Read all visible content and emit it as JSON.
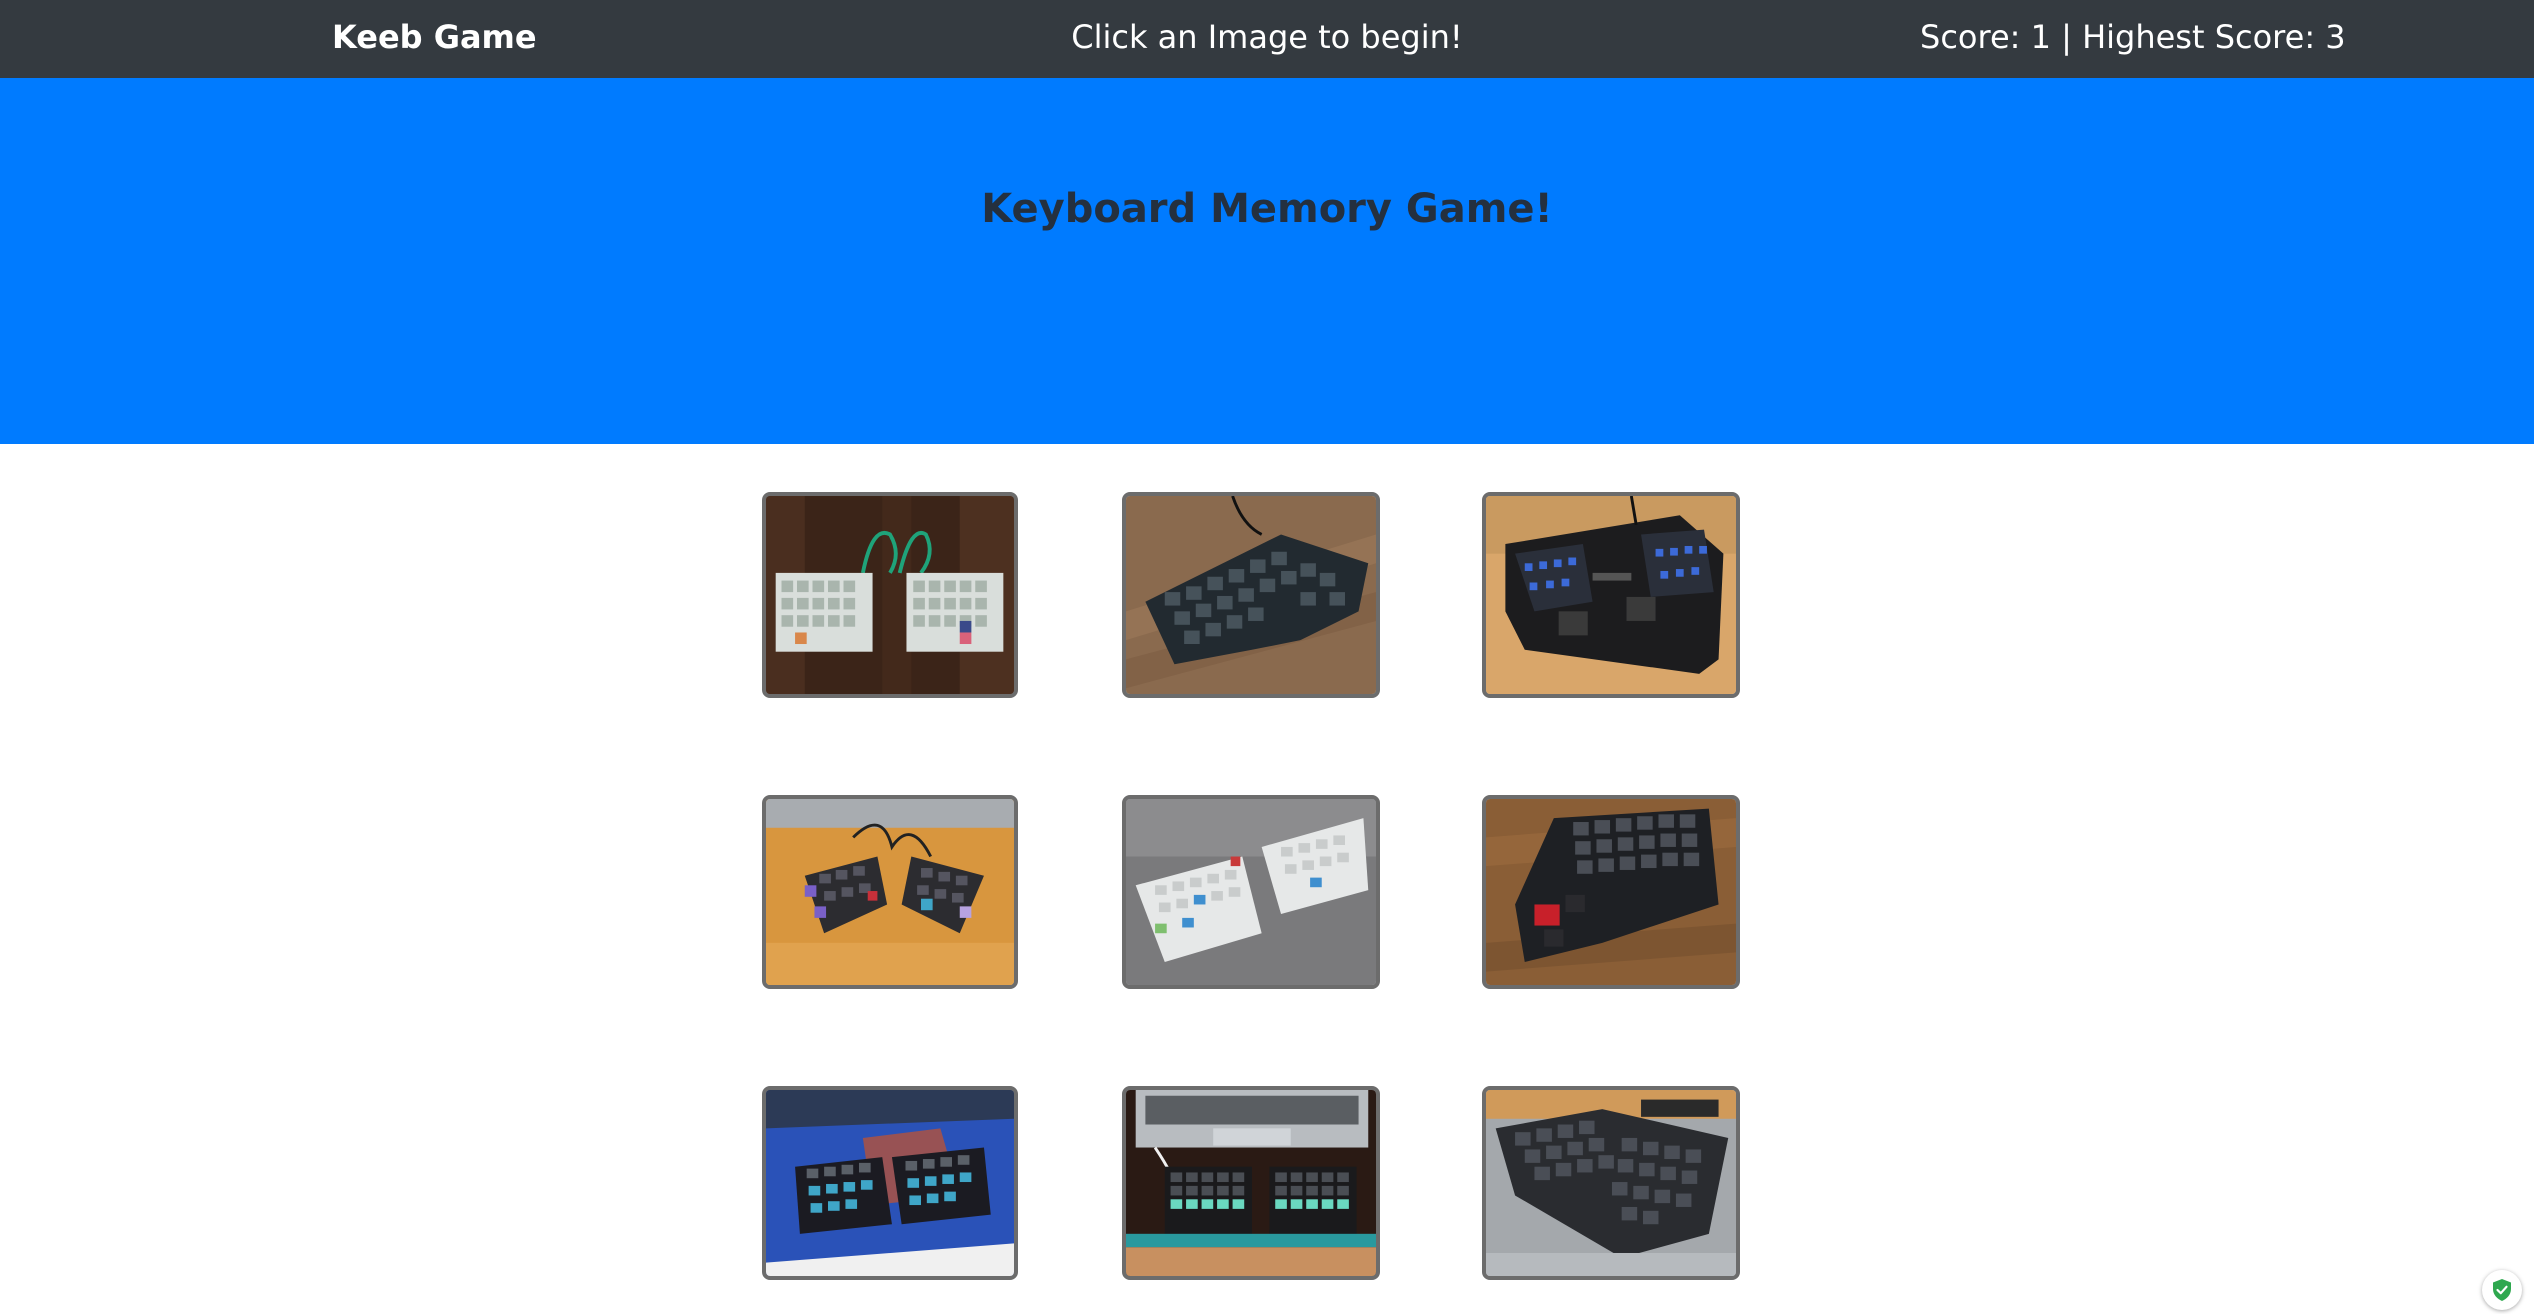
{
  "navbar": {
    "brand": "Keeb Game",
    "message": "Click an Image to begin!",
    "score_text": "Score: 1 | Highest Score: 3"
  },
  "jumbotron": {
    "title": "Keyboard Memory Game!"
  },
  "cards": [
    {
      "name": "split-ortho-keyboard-green-cable",
      "icon": "keyboard-photo"
    },
    {
      "name": "ergodox-keyboard-dark-wood",
      "icon": "keyboard-photo"
    },
    {
      "name": "kinesis-advantage-keyboard",
      "icon": "keyboard-photo"
    },
    {
      "name": "split-keyboard-orange-desk",
      "icon": "keyboard-photo"
    },
    {
      "name": "white-split-keyboard-gray",
      "icon": "keyboard-photo"
    },
    {
      "name": "dark-split-keyboard-red-esc",
      "icon": "keyboard-photo"
    },
    {
      "name": "split-keyboard-blue-mat",
      "icon": "keyboard-photo"
    },
    {
      "name": "split-keyboard-laptop",
      "icon": "keyboard-photo"
    },
    {
      "name": "black-ergo-keyboard-gray-mat",
      "icon": "keyboard-photo"
    }
  ],
  "colors": {
    "navbar_bg": "#343a40",
    "jumbotron_bg": "#007bff",
    "card_border": "#6c6c6c"
  },
  "widget": {
    "icon": "shield-check-icon"
  }
}
